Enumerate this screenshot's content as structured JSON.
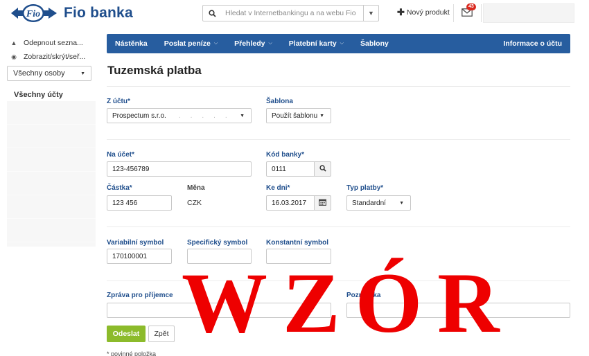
{
  "header": {
    "brand_mark": "Fio",
    "brand_name": "Fio banka",
    "search_placeholder": "Hledat v Internetbankingu a na webu Fio",
    "new_product_label": "Nový produkt",
    "mail_count": "43"
  },
  "sidebar": {
    "pin_label": "Odepnout sezna...",
    "toggle_label": "Zobrazit/skrýt/seř...",
    "persons_select": "Všechny osoby",
    "accounts_title": "Všechny účty"
  },
  "nav": {
    "items": [
      {
        "label": "Nástěnka",
        "dropdown": false
      },
      {
        "label": "Poslat peníze",
        "dropdown": true
      },
      {
        "label": "Přehledy",
        "dropdown": true
      },
      {
        "label": "Platební karty",
        "dropdown": true
      },
      {
        "label": "Šablony",
        "dropdown": false
      }
    ],
    "right_label": "Informace o účtu"
  },
  "page": {
    "title": "Tuzemská platba"
  },
  "form": {
    "from_account_label": "Z účtu*",
    "from_account_value": "Prospectum s.r.o.",
    "template_label": "Šablona",
    "template_value": "Použít šablonu",
    "to_account_label": "Na účet*",
    "to_account_value": "123-456789",
    "bank_code_label": "Kód banky*",
    "bank_code_value": "0111",
    "amount_label": "Částka*",
    "amount_value": "123 456",
    "currency_label": "Měna",
    "currency_value": "CZK",
    "date_label": "Ke dni*",
    "date_value": "16.03.2017",
    "payment_type_label": "Typ platby*",
    "payment_type_value": "Standardní",
    "variable_symbol_label": "Variabilní symbol",
    "variable_symbol_value": "170100001",
    "specific_symbol_label": "Specifický symbol",
    "specific_symbol_value": "",
    "constant_symbol_label": "Konstantní symbol",
    "constant_symbol_value": "",
    "message_label": "Zpráva pro příjemce",
    "message_value": "",
    "note_label": "Poznámka",
    "note_value": "",
    "submit_label": "Odeslat",
    "back_label": "Zpět",
    "required_note": "* povinné položka"
  },
  "watermark": "WZÓR",
  "colors": {
    "brand_blue": "#1f4e8c",
    "nav_blue": "#275d9f",
    "submit_green": "#8cbb2b",
    "watermark_red": "#ee0000",
    "badge_red": "#d9281e"
  }
}
